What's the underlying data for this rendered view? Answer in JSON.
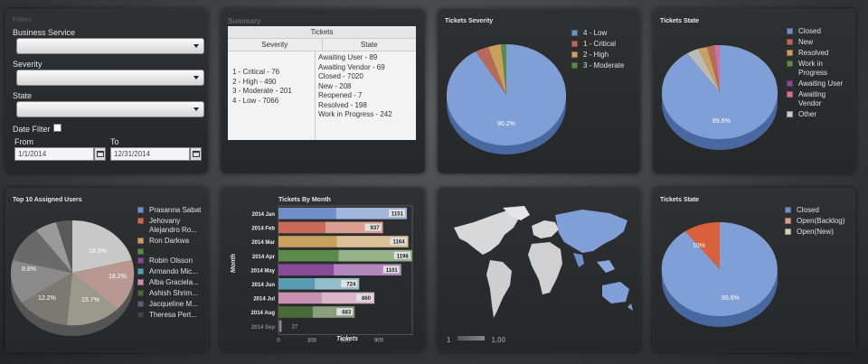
{
  "filters": {
    "title": "Filters",
    "business_service_label": "Business Service",
    "severity_label": "Severity",
    "state_label": "State",
    "date_filter_label": "Date Filter",
    "from_label": "From",
    "to_label": "To",
    "from_value": "1/1/2014",
    "to_value": "12/31/2014"
  },
  "summary": {
    "title": "Summary",
    "table_title": "Tickets",
    "col_severity": "Severity",
    "col_state": "State",
    "severity_items": [
      "1 - Critical - 76",
      "2 - High - 490",
      "3 - Moderate - 201",
      "4 - Low - 7066"
    ],
    "state_items": [
      "Awaiting User - 89",
      "Awaiting Vendor - 69",
      "Closed - 7020",
      "New - 208",
      "Reopened - 7",
      "Resolved - 198",
      "Work in Progress - 242"
    ]
  },
  "severity_chart": {
    "title": "Tickets Severity",
    "legend": [
      {
        "label": "4 - Low",
        "color": "#6f8fc8"
      },
      {
        "label": "1 - Critical",
        "color": "#b86a5a"
      },
      {
        "label": "2 - High",
        "color": "#c8a060"
      },
      {
        "label": "3 - Moderate",
        "color": "#5c8a4a"
      }
    ],
    "pct_label": "90.2%"
  },
  "state_chart": {
    "title": "Tickets State",
    "legend": [
      {
        "label": "Closed",
        "color": "#6f8fc8"
      },
      {
        "label": "New",
        "color": "#b86a5a"
      },
      {
        "label": "Resolved",
        "color": "#c8a060"
      },
      {
        "label": "Work in Progress",
        "color": "#5c8a4a"
      },
      {
        "label": "Awaiting User",
        "color": "#8a4a9a"
      },
      {
        "label": "Awaiting Vendor",
        "color": "#d070a0"
      },
      {
        "label": "Other",
        "color": "#cccccc"
      }
    ],
    "pct_label": "89.6%"
  },
  "users_chart": {
    "title": "Top 10 Assigned Users",
    "legend": [
      {
        "label": "Prasanna Sabat",
        "color": "#6f8fc8"
      },
      {
        "label": "Jehovany Alejandro Ro...",
        "color": "#c86a5a"
      },
      {
        "label": "Ron Darkwa",
        "color": "#c8a060"
      },
      {
        "label": "",
        "color": "#5c8a4a"
      },
      {
        "label": "Robin Olsson",
        "color": "#8a4a9a"
      },
      {
        "label": "Armando Mic...",
        "color": "#5a9ab0"
      },
      {
        "label": "Alba Graciela...",
        "color": "#c890b0"
      },
      {
        "label": "Ashish Shrim...",
        "color": "#4a6a3a"
      },
      {
        "label": "Jacqueline M...",
        "color": "#6a5a7a"
      },
      {
        "label": "Theresa Pert...",
        "color": "#444444"
      }
    ],
    "labels": [
      "18.3%",
      "18.2%",
      "15.7%",
      "12.2%",
      "8.8%"
    ]
  },
  "month_chart": {
    "title": "Tickets By Month",
    "ylabel": "Month",
    "xlabel": "Tickets",
    "ticks": [
      "0",
      "300",
      "600",
      "900"
    ]
  },
  "chart_data": {
    "type": "bar",
    "title": "Tickets By Month",
    "xlabel": "Tickets",
    "ylabel": "Month",
    "categories": [
      "2014 Jan",
      "2014 Feb",
      "2014 Mar",
      "2014 Apr",
      "2014 May",
      "2014 Jun",
      "2014 Jul",
      "2014 Aug",
      "2014 Sep"
    ],
    "values": [
      1151,
      937,
      1164,
      1198,
      1101,
      724,
      860,
      683,
      27
    ],
    "colors": [
      "#6f8fc8",
      "#c86a5a",
      "#c8a060",
      "#5c8a4a",
      "#8a4a9a",
      "#5a9ab0",
      "#c890b0",
      "#4a6a3a",
      "#6a5a7a"
    ],
    "xlim": [
      0,
      1200
    ]
  },
  "map": {
    "legend_min": "1",
    "legend_max": "1.00"
  },
  "state_chart2": {
    "title": "Tickets State",
    "legend": [
      {
        "label": "Closed",
        "color": "#6f8fc8"
      },
      {
        "label": "Open(Backlog)",
        "color": "#d8a090"
      },
      {
        "label": "Open(New)",
        "color": "#d8d0b8"
      }
    ],
    "pct_big": "89.6%",
    "pct_small": "10%"
  }
}
